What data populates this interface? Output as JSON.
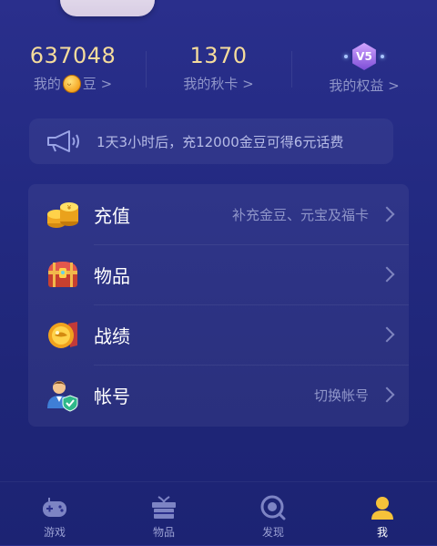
{
  "stats": [
    {
      "value": "637048",
      "label_prefix": "我的",
      "label_suffix": "豆 >",
      "icon": "gold-bean-icon"
    },
    {
      "value": "1370",
      "label": "我的秋卡 >"
    },
    {
      "badge": "V5",
      "label": "我的权益 >",
      "icon": "vip-level-badge-icon"
    }
  ],
  "notice": {
    "icon": "megaphone-icon",
    "text": "1天3小时后，充12000金豆可得6元话费"
  },
  "menu": [
    {
      "label": "充值",
      "hint": "补充金豆、元宝及福卡",
      "icon": "gold-coins-icon"
    },
    {
      "label": "物品",
      "hint": "",
      "icon": "treasure-chest-icon"
    },
    {
      "label": "战绩",
      "hint": "",
      "icon": "medal-icon"
    },
    {
      "label": "帐号",
      "hint": "切换帐号",
      "icon": "user-shield-icon"
    }
  ],
  "tabs": [
    {
      "label": "游戏",
      "icon": "gamepad-icon",
      "active": false
    },
    {
      "label": "物品",
      "icon": "gift-box-icon",
      "active": false
    },
    {
      "label": "发现",
      "icon": "discover-icon",
      "active": false
    },
    {
      "label": "我",
      "icon": "profile-icon",
      "active": true
    }
  ],
  "colors": {
    "stat_value": "#f5dc9c",
    "label": "#8f95c9",
    "bg_top": "#2a2f8c",
    "bg_bottom": "#1c2373",
    "active_tab": "#f5c23a"
  }
}
